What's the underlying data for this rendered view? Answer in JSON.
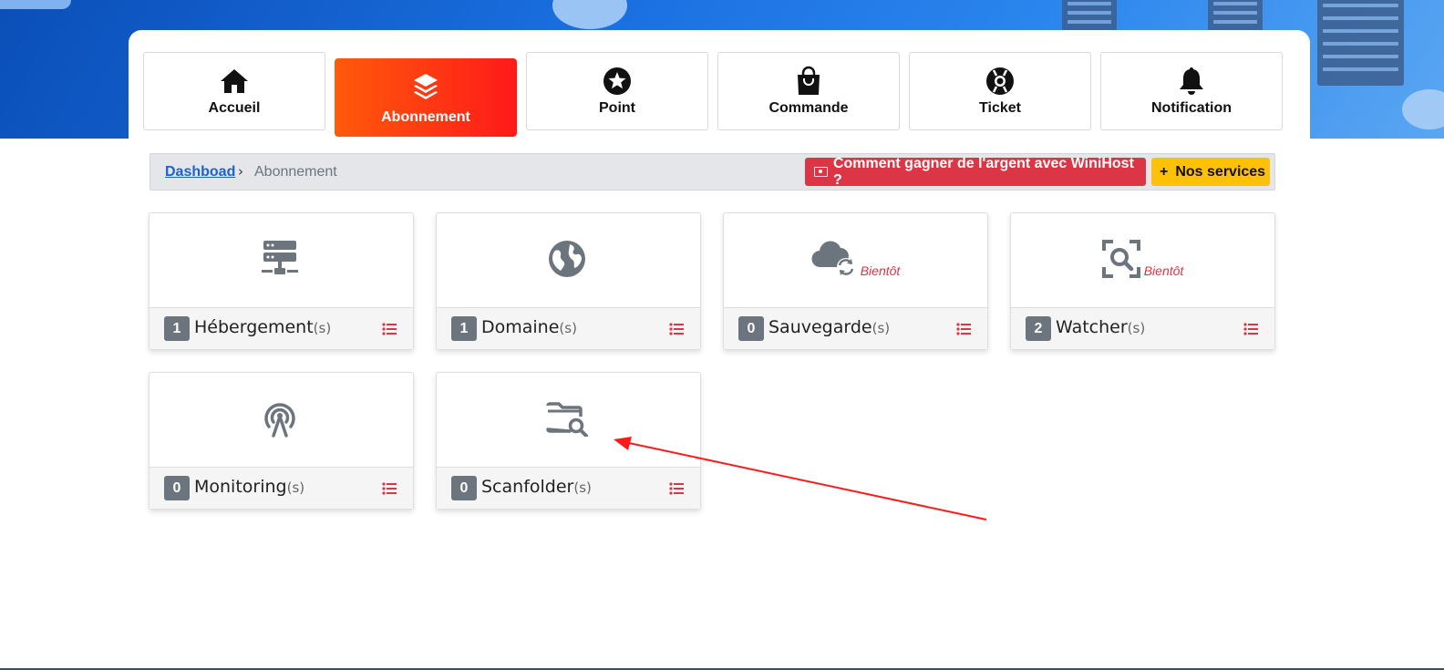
{
  "nav": {
    "items": [
      {
        "label": "Accueil",
        "icon": "home-icon"
      },
      {
        "label": "Abonnement",
        "icon": "layers-icon",
        "active": true
      },
      {
        "label": "Point",
        "icon": "star-icon"
      },
      {
        "label": "Commande",
        "icon": "shopping-bag-icon"
      },
      {
        "label": "Ticket",
        "icon": "lifebuoy-icon"
      },
      {
        "label": "Notification",
        "icon": "bell-icon"
      }
    ]
  },
  "breadcrumb": {
    "link": "Dashboad",
    "separator": "›",
    "current": "Abonnement"
  },
  "actions": {
    "earn_label": "Comment gagner de l'argent avec WiniHost ?",
    "services_label": "Nos services"
  },
  "cards": [
    {
      "count": "1",
      "name": "Hébergement",
      "suffix": "(s)",
      "icon": "server-network-icon",
      "soon": ""
    },
    {
      "count": "1",
      "name": "Domaine",
      "suffix": "(s)",
      "icon": "globe-icon",
      "soon": ""
    },
    {
      "count": "0",
      "name": "Sauvegarde",
      "suffix": "(s)",
      "icon": "cloud-sync-icon",
      "soon": "Bientôt"
    },
    {
      "count": "2",
      "name": "Watcher",
      "suffix": "(s)",
      "icon": "scan-search-icon",
      "soon": "Bientôt"
    },
    {
      "count": "0",
      "name": "Monitoring",
      "suffix": "(s)",
      "icon": "broadcast-tower-icon",
      "soon": ""
    },
    {
      "count": "0",
      "name": "Scanfolder",
      "suffix": "(s)",
      "icon": "folder-search-icon",
      "soon": ""
    }
  ],
  "colors": {
    "active_gradient_start": "#ff5a0a",
    "active_gradient_end": "#ff1a1a",
    "danger": "#dc3545",
    "warning": "#ffc107",
    "badge": "#6c757d",
    "link": "#1a62d6"
  }
}
